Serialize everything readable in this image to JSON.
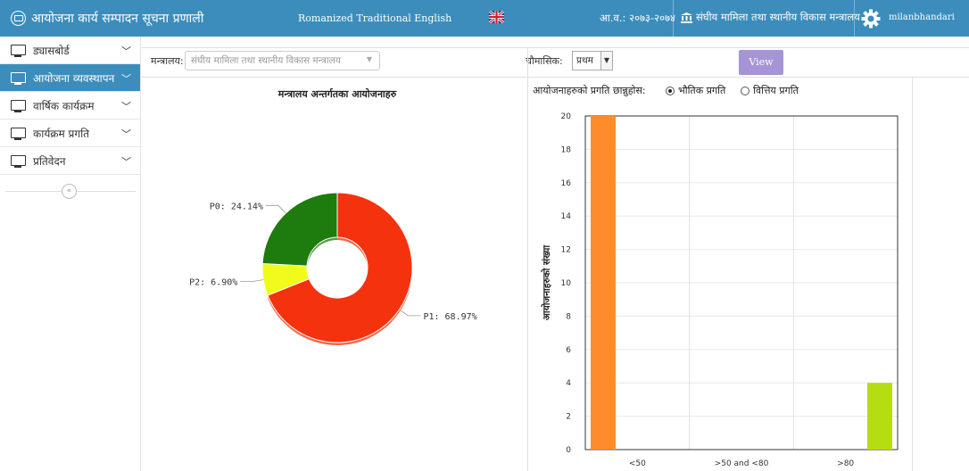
{
  "header": {
    "app_title": "आयोजना कार्य सम्पादन सूचना प्रणाली",
    "language": "Romanized Traditional English",
    "fiscal_year": "आ.व.: २०७३-२०७४",
    "ministry": "संघीय मामिला तथा स्थानीय विकास मन्त्रालय",
    "username": "milanbhandari"
  },
  "sidebar": {
    "items": [
      {
        "label": "ड्यासबोर्ड"
      },
      {
        "label": "आयोजना व्यवस्थापन"
      },
      {
        "label": "वार्षिक कार्यक्रम"
      },
      {
        "label": "कार्यक्रम प्रगति"
      },
      {
        "label": "प्रतिवेदन"
      }
    ],
    "collapse_icon": "«"
  },
  "toolbar": {
    "ministry_label": "मन्त्रालय:",
    "ministry_value": "संघीय मामिला तथा स्थानीय विकास मन्त्रालय",
    "quarter_label": "चौमासिक:",
    "quarter_value": "प्रथम",
    "view_label": "View"
  },
  "progress": {
    "label": "आयोजनाहरुको प्रगति छान्नुहोस:",
    "option_physical": "भौतिक प्रगति",
    "option_financial": "वित्तिय प्रगति",
    "selected": "physical"
  },
  "chart_data": [
    {
      "type": "pie",
      "title": "मन्त्रालय अन्तर्गतका आयोजनाहरु",
      "slices": [
        {
          "label": "P0",
          "value": 24.14,
          "display": "P0: 24.14%",
          "color": "#1e7b0e"
        },
        {
          "label": "P1",
          "value": 68.97,
          "display": "P1: 68.97%",
          "color": "#f4320d"
        },
        {
          "label": "P2",
          "value": 6.9,
          "display": "P2: 6.90%",
          "color": "#f0fb1a"
        }
      ]
    },
    {
      "type": "bar",
      "categories": [
        "<50",
        ">50 and <80",
        ">80"
      ],
      "values": [
        20,
        0,
        4
      ],
      "colors": [
        "#ff8c2a",
        "#cccccc",
        "#b6dc12"
      ],
      "ylabel": "आयोजनाहरुको संख्या",
      "ylim": [
        0,
        20
      ],
      "yticks": [
        0,
        2,
        4,
        6,
        8,
        10,
        12,
        14,
        16,
        18,
        20
      ],
      "grid": true
    }
  ]
}
